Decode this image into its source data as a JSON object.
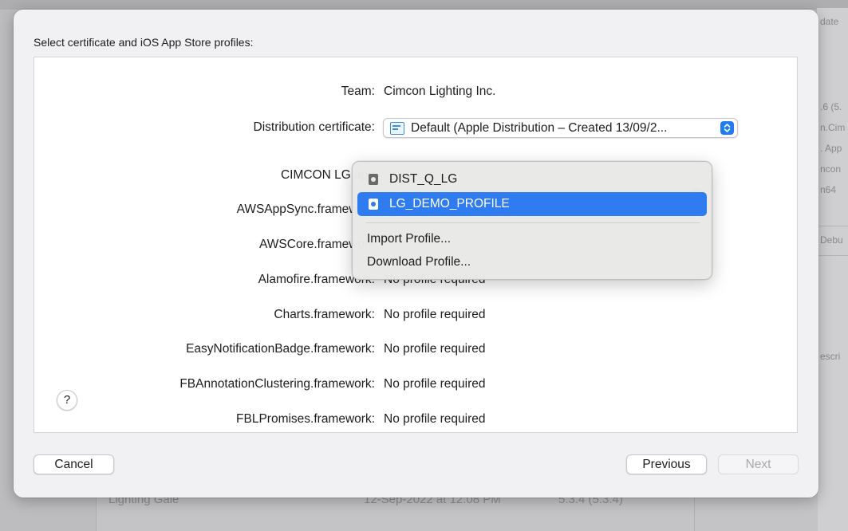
{
  "background": {
    "right_panel_texts": [
      ".6 (5.",
      "n.Cim",
      ". App",
      "ncon",
      "n64",
      "Debu",
      "escri",
      "date"
    ],
    "list_row": {
      "name": "Lighting Gale",
      "date": "12-Sep-2022 at 12:08 PM",
      "version": "5.3.4 (5.3.4)"
    }
  },
  "sheet": {
    "heading": "Select certificate and iOS App Store profiles:",
    "rows": [
      {
        "label": "Team:",
        "value": "Cimcon Lighting Inc."
      },
      {
        "label": "Distribution certificate:",
        "value": "Default (Apple Distribution – Created 13/09/2..."
      },
      {
        "label": "CIMCON LG.app",
        "value": ""
      },
      {
        "label": "AWSAppSync.framework",
        "value": ""
      },
      {
        "label": "AWSCore.framework",
        "value": ""
      },
      {
        "label": "Alamofire.framework:",
        "value": "No profile required"
      },
      {
        "label": "Charts.framework:",
        "value": "No profile required"
      },
      {
        "label": "EasyNotificationBadge.framework:",
        "value": "No profile required"
      },
      {
        "label": "FBAnnotationClustering.framework:",
        "value": "No profile required"
      },
      {
        "label": "FBLPromises.framework:",
        "value": "No profile required"
      }
    ],
    "menu": {
      "profiles": [
        "DIST_Q_LG",
        "LG_DEMO_PROFILE"
      ],
      "selected_profile": "LG_DEMO_PROFILE",
      "actions": [
        "Import Profile...",
        "Download Profile..."
      ]
    },
    "help_label": "?",
    "buttons": {
      "cancel": "Cancel",
      "previous": "Previous",
      "next": "Next"
    }
  },
  "colors": {
    "accent": "#2f7bf0",
    "sheet_bg": "#f1f1f3"
  }
}
